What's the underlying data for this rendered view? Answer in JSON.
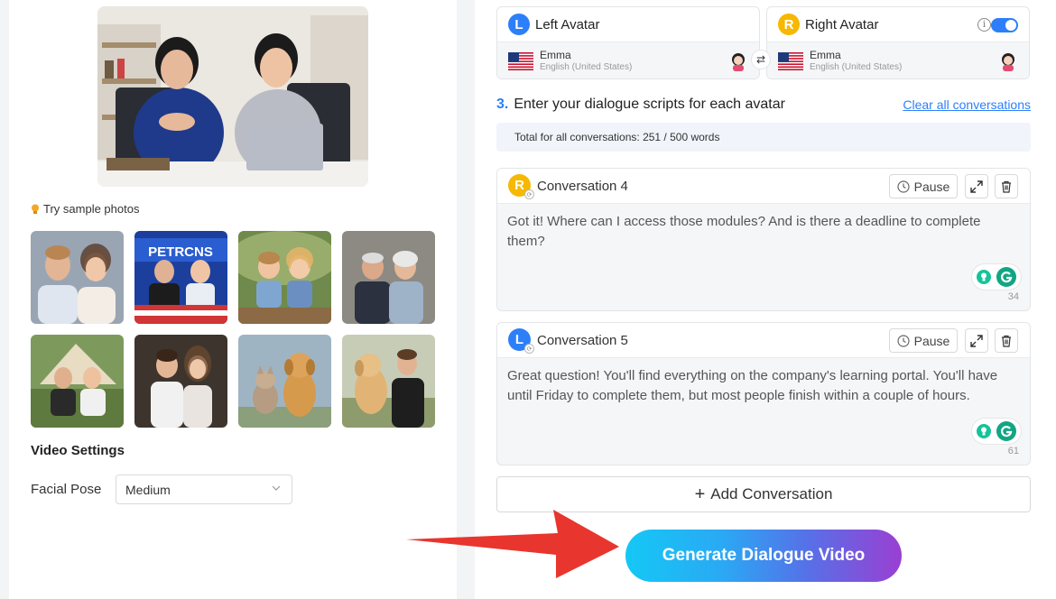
{
  "left": {
    "sample_label": "Try sample photos",
    "video_settings_title": "Video Settings",
    "facial_pose_label": "Facial Pose",
    "facial_pose_value": "Medium",
    "thumb_news_text": "PETRCNS"
  },
  "avatars": {
    "left": {
      "badge": "L",
      "title": "Left Avatar",
      "voice": "Emma",
      "locale": "English (United States)"
    },
    "right": {
      "badge": "R",
      "title": "Right Avatar",
      "voice": "Emma",
      "locale": "English (United States)"
    },
    "swap_glyph": "⇄",
    "info_glyph": "i"
  },
  "script": {
    "step_number": "3.",
    "step_text": "Enter your dialogue scripts for each avatar",
    "clear_label": "Clear all conversations",
    "total_text": "Total for all conversations: 251 / 500 words"
  },
  "conversations": [
    {
      "badge": "R",
      "title": "Conversation 4",
      "pause_label": "Pause",
      "text": "Got it! Where can I access those modules? And is there a deadline to complete them?",
      "count": "34"
    },
    {
      "badge": "L",
      "title": "Conversation 5",
      "pause_label": "Pause",
      "text": "Great question! You'll find everything on the company's learning portal. You'll have until Friday to complete them, but most people finish within a couple of hours.",
      "count": "61"
    }
  ],
  "add_conversation_label": "Add Conversation",
  "add_glyph": "+",
  "generate_label": "Generate Dialogue Video",
  "colors": {
    "accent_blue": "#2d7ff9",
    "right_badge": "#f6b800",
    "arrow_red": "#e8352e"
  }
}
